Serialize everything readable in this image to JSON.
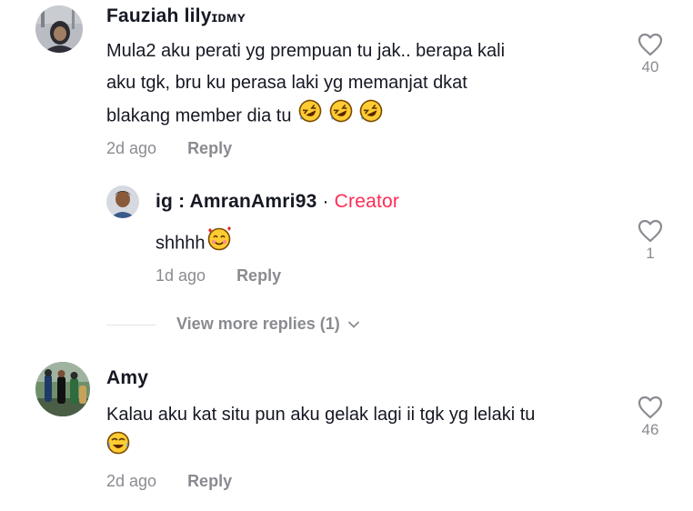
{
  "comments": [
    {
      "username": "Fauziah lily",
      "username_suffix": "ɪᴅᴍʏ",
      "text_lines": [
        "Mula2 aku perati yg prempuan tu jak.. berapa kali",
        "aku tgk, bru ku perasa laki yg memanjat dkat",
        "blakang member dia tu"
      ],
      "emoji": [
        "rofl-emoji",
        "rofl-emoji",
        "rofl-emoji"
      ],
      "time": "2d ago",
      "reply": "Reply",
      "likes": "40"
    },
    {
      "username": "ig : AmranAmri93",
      "badge_sep": "·",
      "badge": "Creator",
      "text": "shhhh",
      "emoji": [
        "smiling-hearts-emoji"
      ],
      "time": "1d ago",
      "reply": "Reply",
      "likes": "1"
    },
    {
      "username": "Amy",
      "text_lines": [
        "Kalau aku kat situ pun aku gelak lagi ii tgk yg lelaki tu"
      ],
      "emoji": [
        "tears-of-joy-emoji"
      ],
      "time": "2d ago",
      "reply": "Reply",
      "likes": "46"
    }
  ],
  "view_more": "View more replies (1)",
  "colors": {
    "creator": "#fe2c55",
    "muted": "#8a8b91",
    "text": "#161823"
  }
}
